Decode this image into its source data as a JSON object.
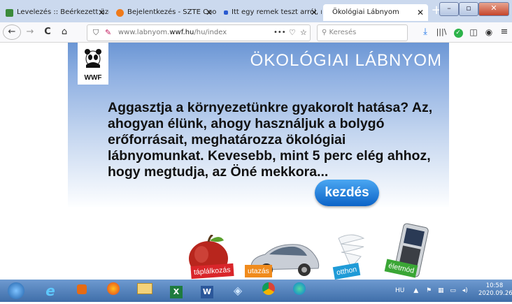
{
  "browser": {
    "tabs": [
      {
        "title": "Levelezés :: Beérkezett üzene",
        "icon_color": "#3a8a3a"
      },
      {
        "title": "Bejelentkezés - SZTE CooSp",
        "icon_color": "#ef7a1a"
      },
      {
        "title": "Itt egy remek teszt arról, mek",
        "icon_color": "#2a5ad0"
      },
      {
        "title": "Ökológiai Lábnyom",
        "icon_color": "#ffffff"
      }
    ],
    "tab_close": "✕",
    "new_tab": "+",
    "window_buttons": {
      "minimize": "–",
      "maximize": "▫",
      "close": "✕"
    },
    "nav": {
      "back": "←",
      "forward": "→",
      "reload": "C",
      "home": "⌂"
    },
    "url": {
      "prefix": "www.labnyom.",
      "domain": "wwf.hu",
      "path": "/hu/index"
    },
    "url_actions": "•••",
    "search_placeholder": "Keresés",
    "toolbar_icons": [
      "download-icon",
      "library-icon",
      "check-icon",
      "sidebar-icon",
      "account-icon",
      "menu-icon"
    ]
  },
  "page": {
    "logo_text": "WWF",
    "heading": "ÖKOLÓGIAI LÁBNYOM",
    "message": "Aggasztja a környezetünkre gyakorolt hatása? Az, ahogyan élünk, ahogy használjuk a bolygó erőforrásait, meghatározza ökológiai lábnyomunkat. Kevesebb, mint 5 perc elég ahhoz, hogy megtudja, az Öné mekkora...",
    "start_button": "kezdés",
    "categories": [
      {
        "label": "táplálkozás",
        "color": "#d9262a"
      },
      {
        "label": "utazás",
        "color": "#f08b1d"
      },
      {
        "label": "otthon",
        "color": "#1f9bd7"
      },
      {
        "label": "életmód",
        "color": "#3aa635"
      }
    ]
  },
  "taskbar": {
    "lang": "HU",
    "time": "10:58",
    "date": "2020.09.26."
  }
}
